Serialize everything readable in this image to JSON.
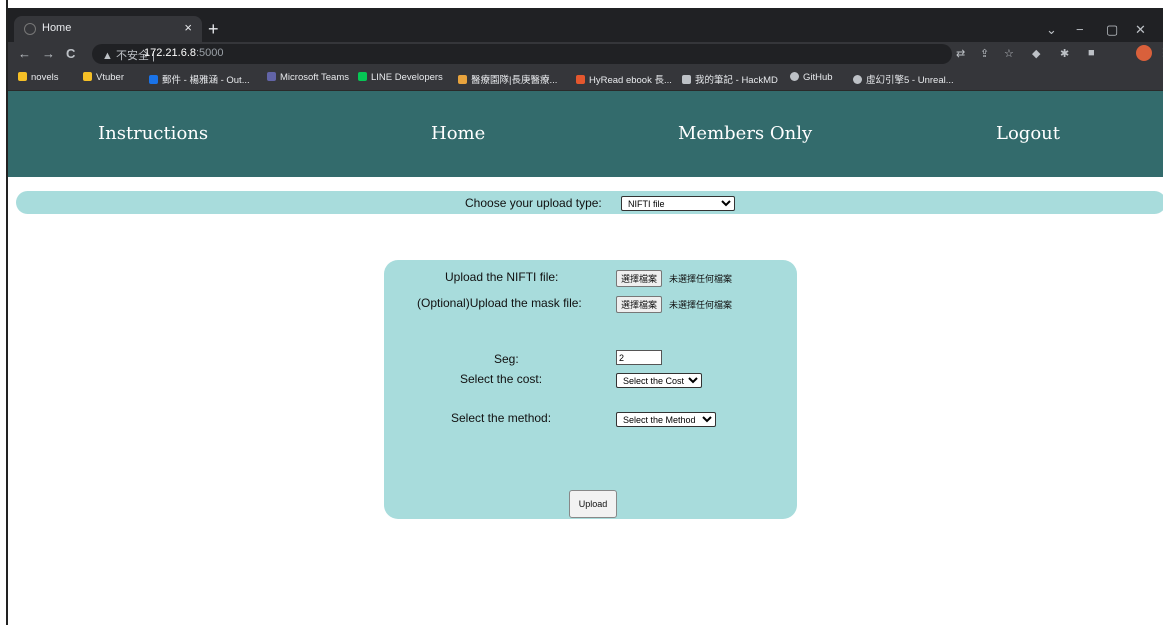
{
  "browser": {
    "tab_title": "Home",
    "tab_close": "×",
    "new_tab": "+",
    "window_controls": [
      "⌄",
      "−",
      "▢",
      "✕"
    ],
    "nav": {
      "back": "←",
      "forward": "→",
      "reload": "C"
    },
    "url": {
      "warning": "▲ 不安全 |",
      "host": "172.21.6.8",
      "port": ":5000"
    },
    "bookmarks": [
      {
        "label": "novels",
        "color": "#f6c026"
      },
      {
        "label": "Vtuber",
        "color": "#f6c026"
      },
      {
        "label": "郵件 - 楊雅涵 - Out...",
        "color": "#1a73e8"
      },
      {
        "label": "Microsoft Teams",
        "color": "#6264a7"
      },
      {
        "label": "LINE Developers",
        "color": "#06c755"
      },
      {
        "label": "醫療園隊|長庚醫療...",
        "color": "#e8a33d"
      },
      {
        "label": "HyRead ebook 長...",
        "color": "#e4572e"
      },
      {
        "label": "我的筆記 - HackMD",
        "color": "#bdc1c6"
      },
      {
        "label": "GitHub",
        "color": "#bdc1c6"
      },
      {
        "label": "虛幻引擎5 - Unreal...",
        "color": "#bdc1c6"
      }
    ]
  },
  "nav": {
    "instructions": "Instructions",
    "home": "Home",
    "members": "Members Only",
    "logout": "Logout"
  },
  "upload_type": {
    "label": "Choose your upload type:",
    "selected": "NIFTI file"
  },
  "form": {
    "nifti_label": "Upload the NIFTI file:",
    "mask_label": "(Optional)Upload the mask file:",
    "choose_file": "選擇檔案",
    "no_file": "未選擇任何檔案",
    "seg_label": "Seg:",
    "seg_value": "2",
    "cost_label": "Select the cost:",
    "cost_selected": "Select the Cost",
    "method_label": "Select the method:",
    "method_selected": "Select the Method",
    "upload_button": "Upload"
  },
  "colors": {
    "navbar": "#336b6c",
    "panel": "#a8dcdc"
  }
}
